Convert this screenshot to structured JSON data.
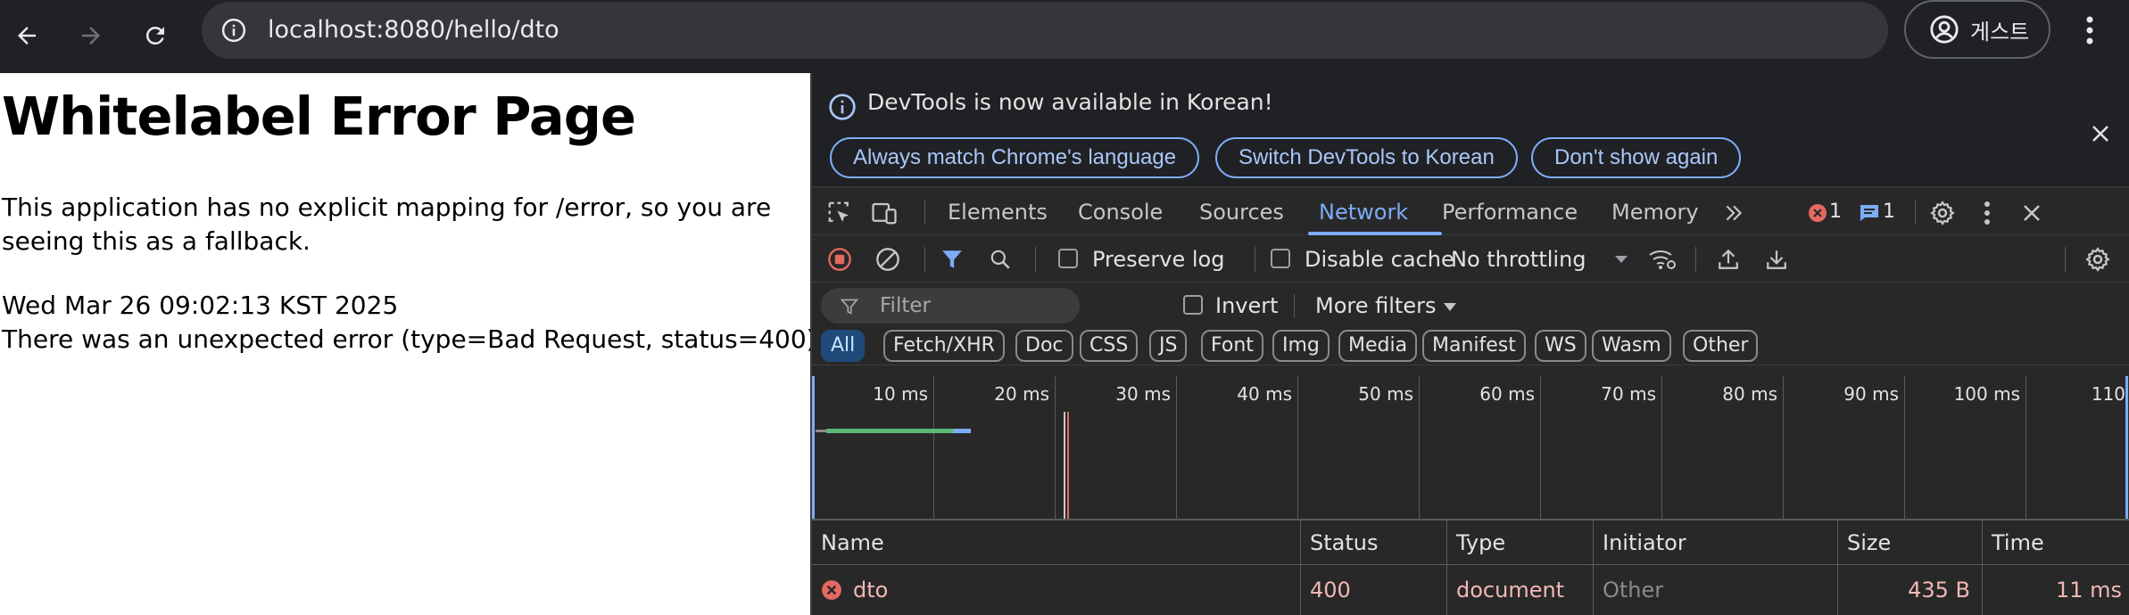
{
  "browser": {
    "url": "localhost:8080/hello/dto",
    "profile_label": "게스트"
  },
  "page": {
    "title": "Whitelabel Error Page",
    "message": "This application has no explicit mapping for /error, so you are seeing this as a fallback.",
    "timestamp": "Wed Mar 26 09:02:13 KST 2025",
    "error": "There was an unexpected error (type=Bad Request, status=400)."
  },
  "devtools": {
    "infobar": {
      "text": "DevTools is now available in Korean!",
      "buttons": [
        "Always match Chrome's language",
        "Switch DevTools to Korean",
        "Don't show again"
      ]
    },
    "tabs": [
      "Elements",
      "Console",
      "Sources",
      "Network",
      "Performance",
      "Memory"
    ],
    "active_tab": "Network",
    "error_count": "1",
    "message_count": "1",
    "network": {
      "preserve_log": "Preserve log",
      "disable_cache": "Disable cache",
      "throttling": "No throttling",
      "filter_placeholder": "Filter",
      "invert": "Invert",
      "more_filters": "More filters",
      "types": [
        "All",
        "Fetch/XHR",
        "Doc",
        "CSS",
        "JS",
        "Font",
        "Img",
        "Media",
        "Manifest",
        "WS",
        "Wasm",
        "Other"
      ],
      "active_type": "All",
      "timeline_ticks": [
        "10 ms",
        "20 ms",
        "30 ms",
        "40 ms",
        "50 ms",
        "60 ms",
        "70 ms",
        "80 ms",
        "90 ms",
        "100 ms",
        "110"
      ],
      "columns": [
        "Name",
        "Status",
        "Type",
        "Initiator",
        "Size",
        "Time"
      ],
      "rows": [
        {
          "name": "dto",
          "status": "400",
          "type": "document",
          "initiator": "Other",
          "size": "435 B",
          "time": "11 ms"
        }
      ]
    }
  },
  "colors": {
    "accent": "#7cacf8",
    "error": "#f2b8b5",
    "error_icon": "#e46962",
    "active_chip_bg": "#1f4a7a"
  }
}
